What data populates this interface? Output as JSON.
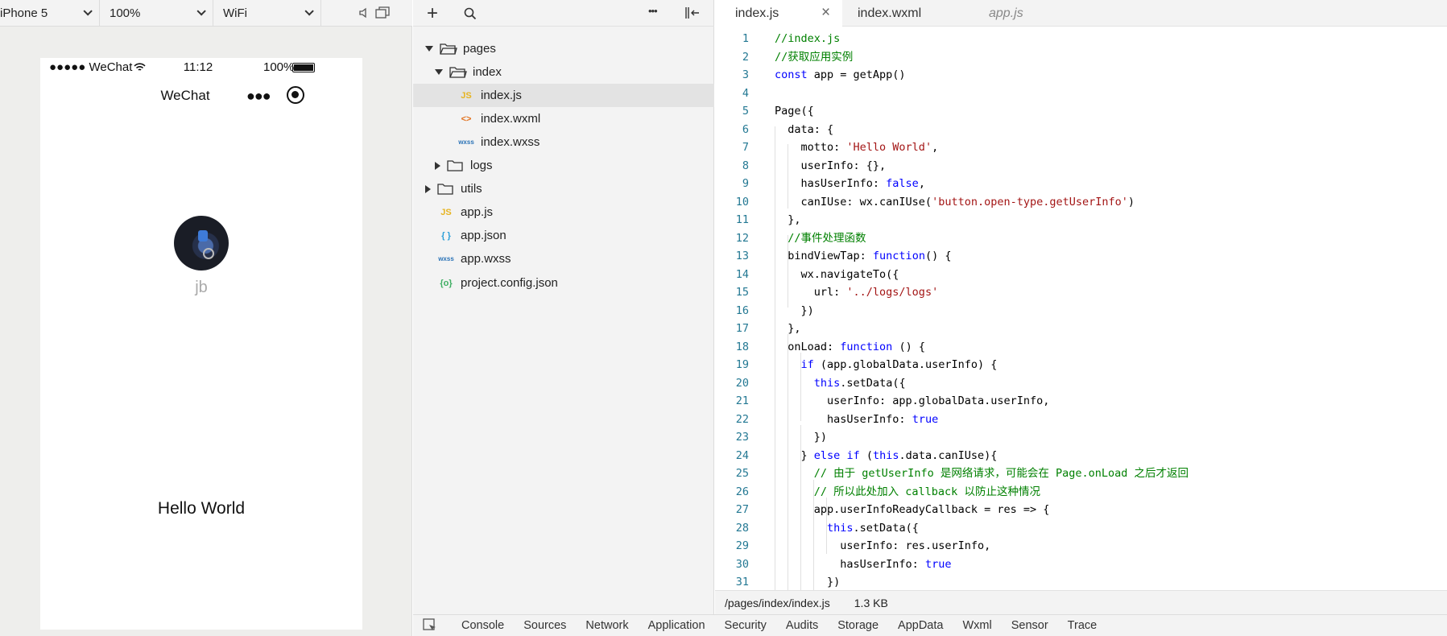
{
  "simulator": {
    "device": "iPhone 5",
    "zoom": "100%",
    "network": "WiFi",
    "status_bar": {
      "carrier": "●●●●● WeChat",
      "time": "11:12",
      "battery": "100%"
    },
    "nav_title": "WeChat",
    "user_nickname": "jb",
    "motto": "Hello World"
  },
  "file_tree": {
    "items": [
      {
        "label": "pages",
        "icon": "folder-open-icon"
      },
      {
        "label": "index",
        "icon": "folder-open-icon"
      },
      {
        "label": "index.js",
        "icon": "js-file-icon",
        "icon_text": "JS",
        "icon_color": "#e6b422"
      },
      {
        "label": "index.wxml",
        "icon": "wxml-file-icon",
        "icon_text": "<>",
        "icon_color": "#e2711d"
      },
      {
        "label": "index.wxss",
        "icon": "wxss-file-icon",
        "icon_text": "wxss",
        "icon_color": "#2b73b7"
      },
      {
        "label": "logs",
        "icon": "folder-icon"
      },
      {
        "label": "utils",
        "icon": "folder-icon"
      },
      {
        "label": "app.js",
        "icon": "js-file-icon",
        "icon_text": "JS",
        "icon_color": "#e6b422"
      },
      {
        "label": "app.json",
        "icon": "json-file-icon",
        "icon_text": "{ }",
        "icon_color": "#2b9fd8"
      },
      {
        "label": "app.wxss",
        "icon": "wxss-file-icon",
        "icon_text": "wxss",
        "icon_color": "#2b73b7"
      },
      {
        "label": "project.config.json",
        "icon": "config-file-icon",
        "icon_text": "{o}",
        "icon_color": "#3fae63"
      }
    ]
  },
  "editor": {
    "tabs": [
      {
        "label": "index.js",
        "active": true
      },
      {
        "label": "index.wxml",
        "active": false
      },
      {
        "label": "app.js",
        "active": false,
        "italic": true
      }
    ],
    "lines": [
      "//index.js",
      "//获取应用实例",
      "const app = getApp()",
      "",
      "Page({",
      "  data: {",
      "    motto: 'Hello World',",
      "    userInfo: {},",
      "    hasUserInfo: false,",
      "    canIUse: wx.canIUse('button.open-type.getUserInfo')",
      "  },",
      "  //事件处理函数",
      "  bindViewTap: function() {",
      "    wx.navigateTo({",
      "      url: '../logs/logs'",
      "    })",
      "  },",
      "  onLoad: function () {",
      "    if (app.globalData.userInfo) {",
      "      this.setData({",
      "        userInfo: app.globalData.userInfo,",
      "        hasUserInfo: true",
      "      })",
      "    } else if (this.data.canIUse){",
      "      // 由于 getUserInfo 是网络请求，可能会在 Page.onLoad 之后才返回",
      "      // 所以此处加入 callback 以防止这种情况",
      "      app.userInfoReadyCallback = res => {",
      "        this.setData({",
      "          userInfo: res.userInfo,",
      "          hasUserInfo: true",
      "        })"
    ],
    "file_path": "/pages/index/index.js",
    "file_size": "1.3 KB"
  },
  "devtools_tabs": [
    "Console",
    "Sources",
    "Network",
    "Application",
    "Security",
    "Audits",
    "Storage",
    "AppData",
    "Wxml",
    "Sensor",
    "Trace"
  ]
}
